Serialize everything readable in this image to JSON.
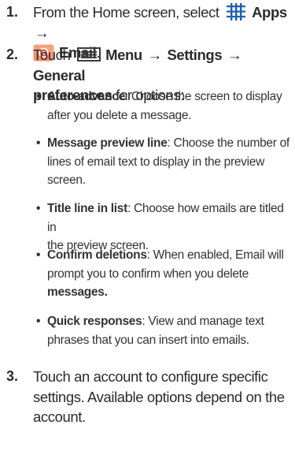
{
  "steps": [
    {
      "number": "1.",
      "pre": "From the Home screen, select",
      "apps_label": "Apps",
      "arrow": "→",
      "email_label": "Email",
      "end": "."
    },
    {
      "number": "2.",
      "pre": "Touch",
      "menu_label": "Menu",
      "arrow1": "→",
      "settings_label": "Settings",
      "arrow2": "→",
      "general_label": "General",
      "preferences_label": "preferences",
      "post": " for options:"
    },
    {
      "number": "3.",
      "text_line1": "Touch an account to configure specific",
      "text_line2": "settings. Available options depend on the",
      "text_line3": "account."
    }
  ],
  "options": [
    {
      "bullet": "•",
      "term": "Auto-advance",
      "line1": ": Choose the screen to display",
      "line2": "after you delete a message."
    },
    {
      "bullet": "•",
      "term": "Message preview line",
      "line1": ": Choose the number of",
      "line2": "lines of email text to display in the preview",
      "line3": "screen."
    },
    {
      "bullet": "•",
      "term": "Title line in list",
      "line1": ": Choose how emails are titled in",
      "line2": "the preview screen."
    },
    {
      "bullet": "•",
      "term": "Confirm deletions",
      "line1": ": When enabled, Email will",
      "line2": "prompt you to confirm when you delete",
      "line3_bold": "messages."
    },
    {
      "bullet": "•",
      "term": "Quick responses",
      "line1": ": View and manage text",
      "line2": "phrases that you can insert into emails."
    }
  ],
  "icons": {
    "apps_icon": "apps-grid-icon",
    "email_icon": "email-app-icon",
    "menu_icon": "menu-key-icon"
  },
  "colors": {
    "apps_icon": "#1f5fb0",
    "email_icon_bg": "#f07a4a",
    "text": "#2b2b2b"
  }
}
